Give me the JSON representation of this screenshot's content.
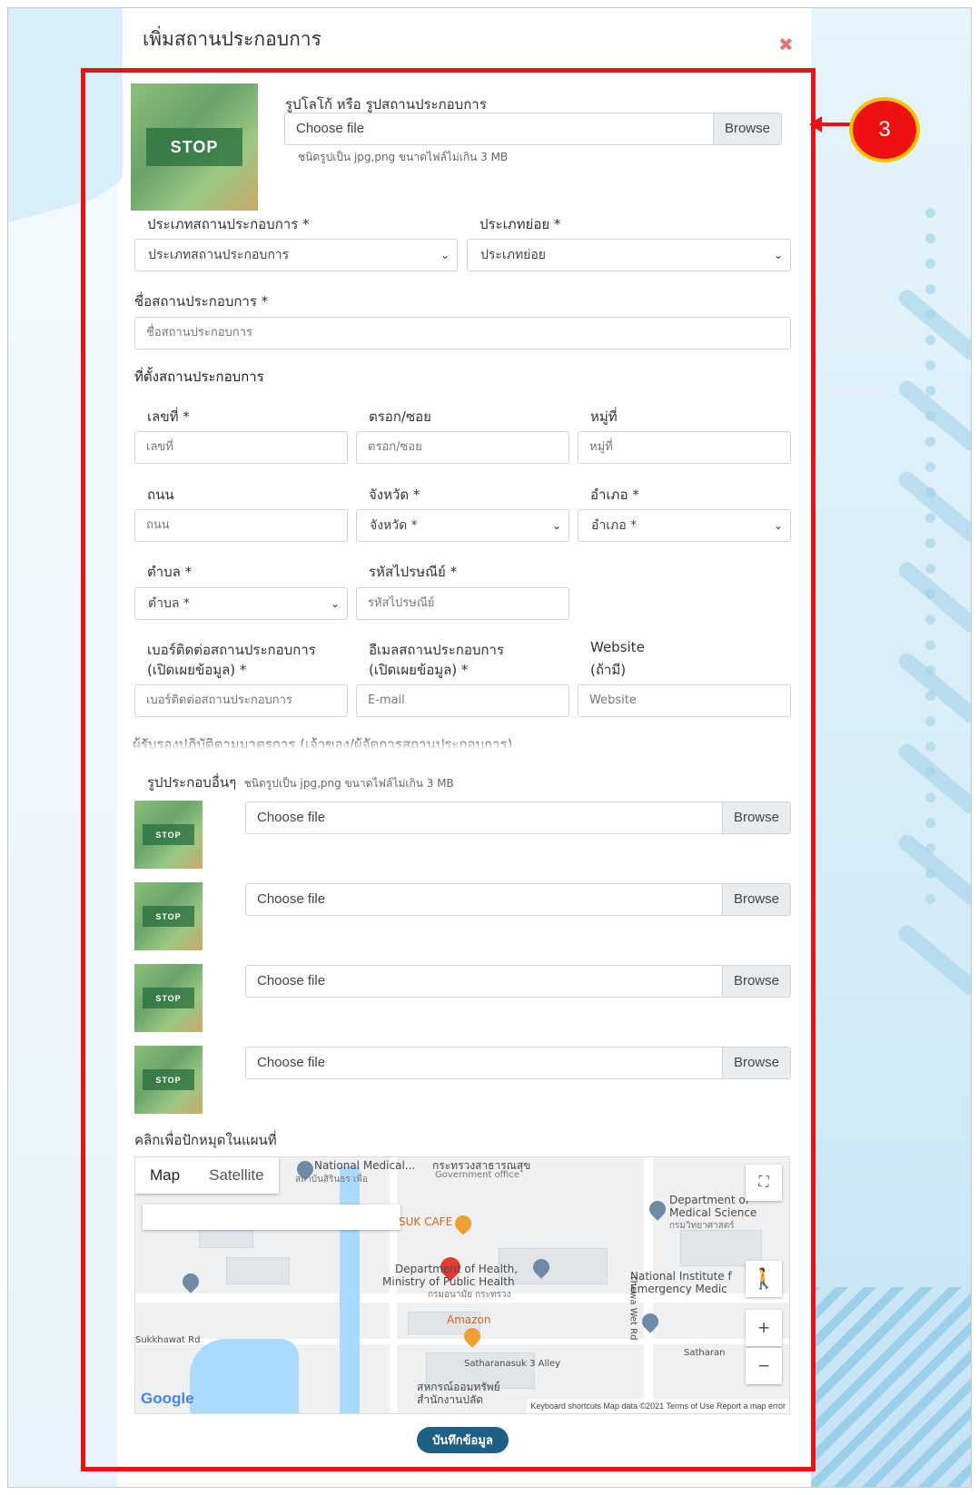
{
  "modal": {
    "title": "เพิ่มสถานประกอบการ",
    "close_icon": "close-icon"
  },
  "callout": {
    "number": "3"
  },
  "logo_upload": {
    "label": "รูปโลโก้ หรือ รูปสถานประกอบการ",
    "file_placeholder": "Choose file",
    "browse_label": "Browse",
    "hint": "ชนิดรูปเป็น jpg,png ขนาดไฟล์ไม่เกิน 3 MB",
    "thumb_text": "STOP"
  },
  "business_type": {
    "label": "ประเภทสถานประกอบการ *",
    "value": "ประเภทสถานประกอบการ"
  },
  "sub_type": {
    "label": "ประเภทย่อย *",
    "value": "ประเภทย่อย"
  },
  "business_name": {
    "label": "ชื่อสถานประกอบการ *",
    "placeholder": "ชื่อสถานประกอบการ"
  },
  "location_section": "ที่ตั้งสถานประกอบการ",
  "address": {
    "house_no": {
      "label": "เลขที่ *",
      "placeholder": "เลขที่"
    },
    "alley": {
      "label": "ตรอก/ซอย",
      "placeholder": "ตรอก/ซอย"
    },
    "village": {
      "label": "หมู่ที่",
      "placeholder": "หมู่ที่"
    },
    "road": {
      "label": "ถนน",
      "placeholder": "ถนน"
    },
    "province": {
      "label": "จังหวัด *",
      "value": "จังหวัด *"
    },
    "district": {
      "label": "อำเภอ *",
      "value": "อำเภอ *"
    },
    "subdistrict": {
      "label": "ตำบล *",
      "value": "ตำบล *"
    },
    "postcode": {
      "label": "รหัสไปรษณีย์ *",
      "placeholder": "รหัสไปรษณีย์"
    }
  },
  "contact": {
    "phone": {
      "label_1": "เบอร์ติดต่อสถานประกอบการ",
      "label_2": "(เปิดเผยข้อมูล) *",
      "placeholder": "เบอร์ติดต่อสถานประกอบการ"
    },
    "email": {
      "label_1": "อีเมลสถานประกอบการ",
      "label_2": "(เปิดเผยข้อมูล) *",
      "placeholder": "E-mail"
    },
    "website": {
      "label_1": "Website",
      "label_2": "(ถ้ามี)",
      "placeholder": "Website"
    }
  },
  "cut_text": "ผู้รับรองปฏิบัติตามมาตรการ (เจ้าของ/ผู้จัดการสถานประกอบการ)",
  "other_images": {
    "label": "รูปประกอบอื่นๆ",
    "hint": "ชนิดรูปเป็น jpg,png ขนาดไฟล์ไม่เกิน 3 MB",
    "files": [
      {
        "placeholder": "Choose file",
        "browse": "Browse"
      },
      {
        "placeholder": "Choose file",
        "browse": "Browse"
      },
      {
        "placeholder": "Choose file",
        "browse": "Browse"
      },
      {
        "placeholder": "Choose file",
        "browse": "Browse"
      }
    ]
  },
  "map": {
    "label": "คลิกเพื่อปักหมุดในแผนที่",
    "tab_map": "Map",
    "tab_satellite": "Satellite",
    "places": {
      "national_medical": "National Medical...",
      "national_medical_th": "สถาบันสิรินธร เพื่อ",
      "moph_th": "กระทรวงสาธารณสุข",
      "gov_office": "Government office",
      "dept_med_sci_1": "Department of",
      "dept_med_sci_2": "Medical Science",
      "dept_med_sci_th": "กรมวิทยาศาสตร์",
      "suk_cafe": "SUK CAFE",
      "dept_health_1": "Department of Health,",
      "dept_health_2": "Ministry of Public Health",
      "dept_health_th": "กรมอนามัย กระทรวง",
      "nat_inst_1": "National Institute f",
      "nat_inst_2": "Emergency Medic",
      "amazon": "Amazon",
      "sukkhawat": "Sukkhawat Rd",
      "tiwanon": "Thewa Wet Rd",
      "satharanasuk": "Satharanasuk 3 Alley",
      "satharan": "Satharan",
      "coop_th": "สหกรณ์ออมทรัพย์",
      "coop_th2": "สำนักงานปลัด"
    },
    "logo": "Google",
    "footer": "Keyboard shortcuts   Map data ©2021   Terms of Use   Report a map error",
    "zoom_in": "+",
    "zoom_out": "−"
  },
  "save_button": "บันทึกข้อมูล"
}
